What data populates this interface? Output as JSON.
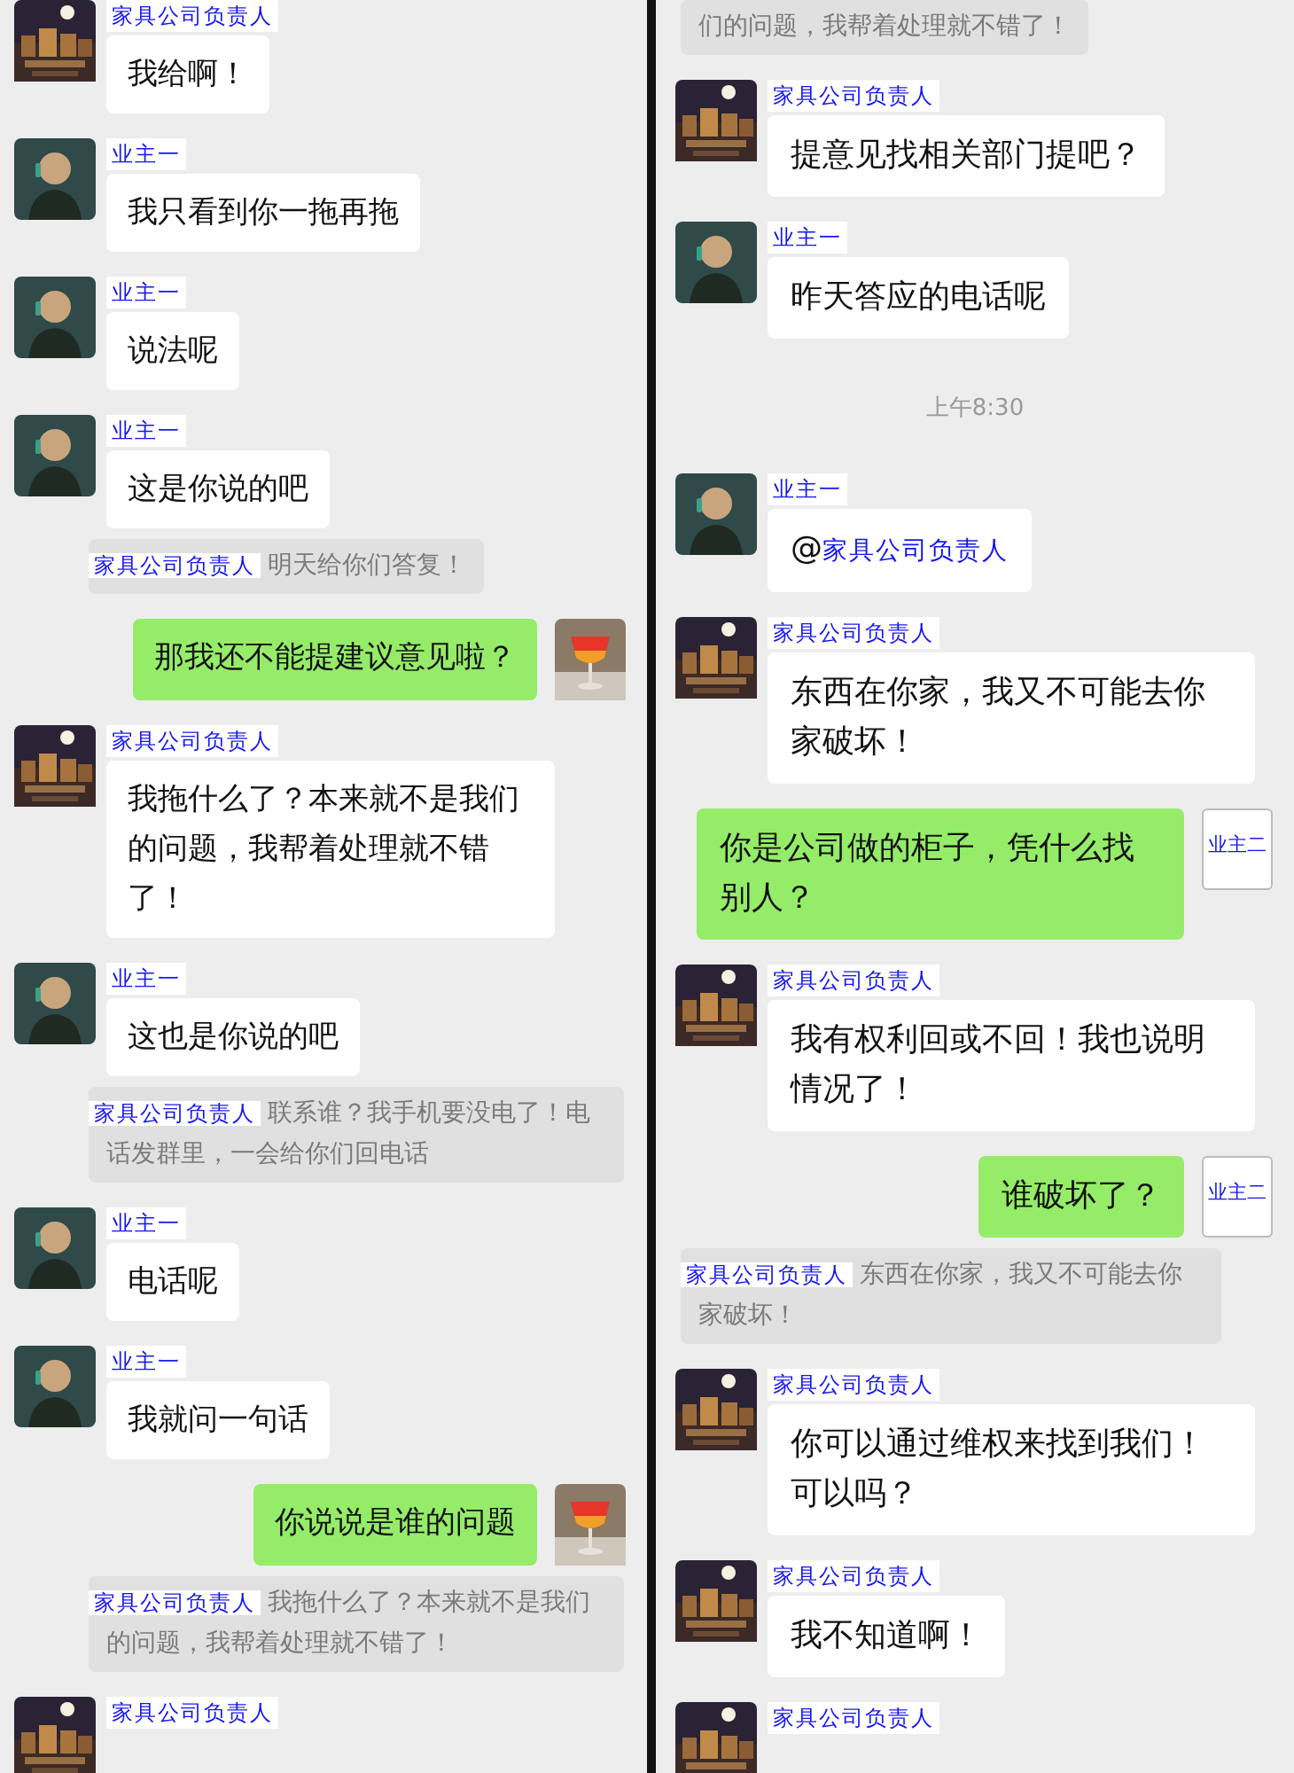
{
  "panels": [
    {
      "messages": [
        {
          "kind": "received",
          "sender": "家具公司负责人",
          "avatar": {
            "kind": "city"
          },
          "text": "我给啊！"
        },
        {
          "kind": "received",
          "sender": "业主一",
          "avatar": {
            "kind": "person"
          },
          "text": "我只看到你一拖再拖"
        },
        {
          "kind": "received",
          "sender": "业主一",
          "avatar": {
            "kind": "person"
          },
          "text": "说法呢"
        },
        {
          "kind": "received",
          "sender": "业主一",
          "avatar": {
            "kind": "person"
          },
          "text": "这是你说的吧"
        },
        {
          "kind": "quote",
          "sender": "家具公司负责人",
          "text": "明天给你们答复！"
        },
        {
          "kind": "sent",
          "avatar": {
            "kind": "drink"
          },
          "text": "那我还不能提建议意见啦？"
        },
        {
          "kind": "received",
          "sender": "家具公司负责人",
          "avatar": {
            "kind": "city"
          },
          "text": "我拖什么了？本来就不是我们的问题，我帮着处理就不错了！"
        },
        {
          "kind": "received",
          "sender": "业主一",
          "avatar": {
            "kind": "person"
          },
          "text": "这也是你说的吧"
        },
        {
          "kind": "quote",
          "sender": "家具公司负责人",
          "text": "联系谁？我手机要没电了！电话发群里，一会给你们回电话"
        },
        {
          "kind": "received",
          "sender": "业主一",
          "avatar": {
            "kind": "person"
          },
          "text": "电话呢"
        },
        {
          "kind": "received",
          "sender": "业主一",
          "avatar": {
            "kind": "person"
          },
          "text": "我就问一句话"
        },
        {
          "kind": "sent",
          "avatar": {
            "kind": "drink"
          },
          "text": "你说说是谁的问题"
        },
        {
          "kind": "quote",
          "sender": "家具公司负责人",
          "text": "我拖什么了？本来就不是我们的问题，我帮着处理就不错了！"
        },
        {
          "kind": "received",
          "sender": "家具公司负责人",
          "avatar": {
            "kind": "city"
          }
        }
      ]
    },
    {
      "messages": [
        {
          "kind": "quote",
          "text": "们的问题，我帮着处理就不错了！"
        },
        {
          "kind": "received",
          "sender": "家具公司负责人",
          "avatar": {
            "kind": "city"
          },
          "text": "提意见找相关部门提吧？"
        },
        {
          "kind": "received",
          "sender": "业主一",
          "avatar": {
            "kind": "person"
          },
          "text": "昨天答应的电话呢"
        },
        {
          "kind": "time",
          "text": "上午8:30"
        },
        {
          "kind": "received",
          "sender": "业主一",
          "avatar": {
            "kind": "person"
          },
          "text": "@",
          "mention": "家具公司负责人"
        },
        {
          "kind": "received",
          "sender": "家具公司负责人",
          "avatar": {
            "kind": "city"
          },
          "text": "东西在你家，我又不可能去你家破坏！"
        },
        {
          "kind": "sent",
          "avatar": {
            "kind": "label",
            "label": "业主二"
          },
          "text": "你是公司做的柜子，凭什么找别人？"
        },
        {
          "kind": "received",
          "sender": "家具公司负责人",
          "avatar": {
            "kind": "city"
          },
          "text": "我有权利回或不回！我也说明情况了！"
        },
        {
          "kind": "sent",
          "avatar": {
            "kind": "label",
            "label": "业主二"
          },
          "text": "谁破坏了？"
        },
        {
          "kind": "quote",
          "sender": "家具公司负责人",
          "text": "东西在你家，我又不可能去你家破坏！"
        },
        {
          "kind": "received",
          "sender": "家具公司负责人",
          "avatar": {
            "kind": "city"
          },
          "text": "你可以通过维权来找到我们！可以吗？"
        },
        {
          "kind": "received",
          "sender": "家具公司负责人",
          "avatar": {
            "kind": "city"
          },
          "text": "我不知道啊！"
        },
        {
          "kind": "received",
          "sender": "家具公司负责人",
          "avatar": {
            "kind": "city"
          }
        }
      ]
    }
  ]
}
